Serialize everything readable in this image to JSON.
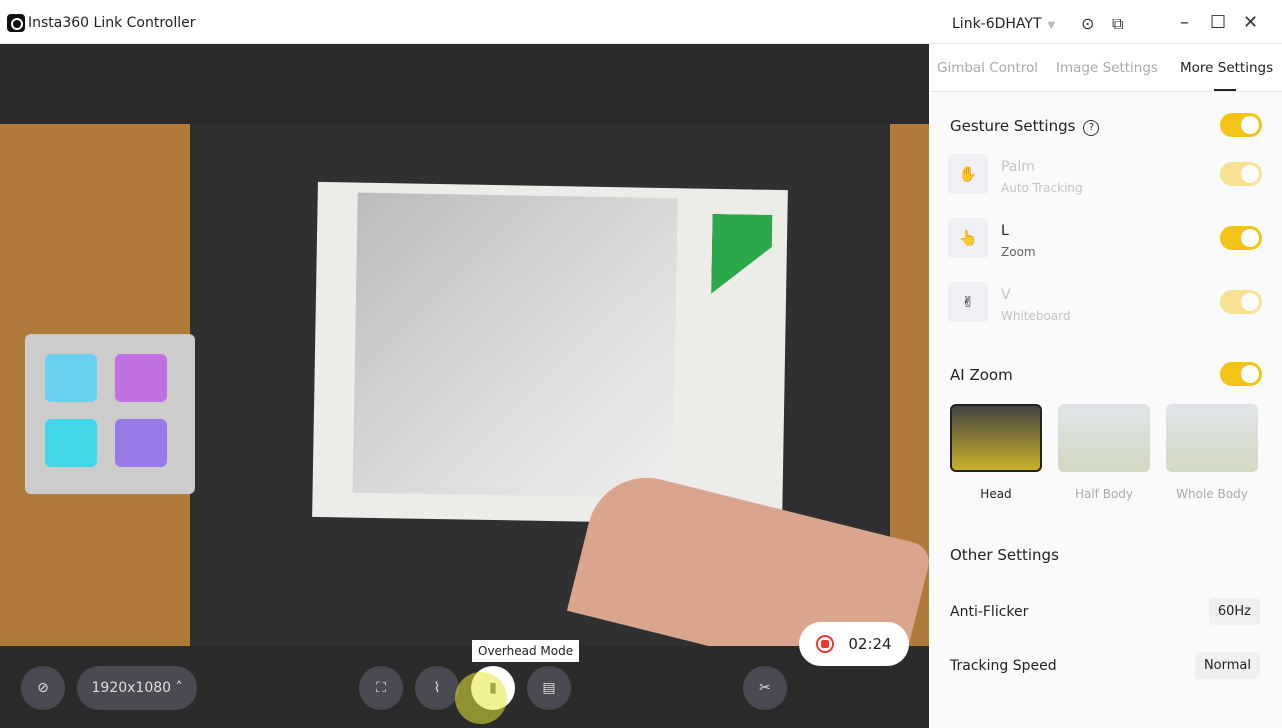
{
  "app": {
    "title": "Insta360 Link Controller",
    "device": "Link-6DHAYT"
  },
  "tabs": [
    {
      "label": "Gimbal Control"
    },
    {
      "label": "Image Settings"
    },
    {
      "label": "More Settings"
    }
  ],
  "gesture": {
    "title": "Gesture Settings",
    "help": "?",
    "enabled": true,
    "items": [
      {
        "name": "Palm",
        "desc": "Auto Tracking",
        "enabled": true,
        "dimmed": true
      },
      {
        "name": "L",
        "desc": "Zoom",
        "enabled": true,
        "dimmed": false
      },
      {
        "name": "V",
        "desc": "Whiteboard",
        "enabled": true,
        "dimmed": true
      }
    ]
  },
  "ai_zoom": {
    "title": "AI Zoom",
    "enabled": true,
    "modes": [
      {
        "label": "Head",
        "selected": true
      },
      {
        "label": "Half Body"
      },
      {
        "label": "Whole Body"
      }
    ]
  },
  "other": {
    "title": "Other Settings",
    "anti_flicker": {
      "label": "Anti-Flicker",
      "value": "60Hz"
    },
    "tracking_speed": {
      "label": "Tracking Speed",
      "value": "Normal"
    }
  },
  "controls": {
    "resolution": "1920x1080",
    "tooltip": "Overhead Mode",
    "record_time": "02:24"
  },
  "colors": {
    "accent": "#f3c318",
    "record": "#e33333"
  }
}
